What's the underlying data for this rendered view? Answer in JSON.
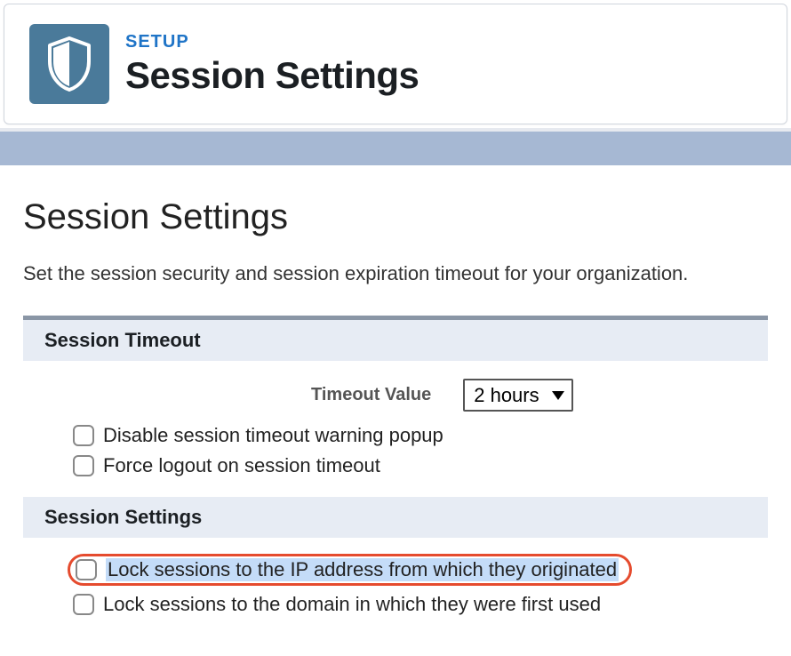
{
  "header": {
    "eyebrow": "SETUP",
    "title": "Session Settings"
  },
  "page": {
    "title": "Session Settings",
    "description": "Set the session security and session expiration timeout for your organization."
  },
  "sections": {
    "timeout": {
      "heading": "Session Timeout",
      "timeout_label": "Timeout Value",
      "timeout_value": "2 hours",
      "disable_popup_label": "Disable session timeout warning popup",
      "force_logout_label": "Force logout on session timeout"
    },
    "session": {
      "heading": "Session Settings",
      "lock_ip_label": "Lock sessions to the IP address from which they originated",
      "lock_domain_label": "Lock sessions to the domain in which they were first used"
    }
  }
}
